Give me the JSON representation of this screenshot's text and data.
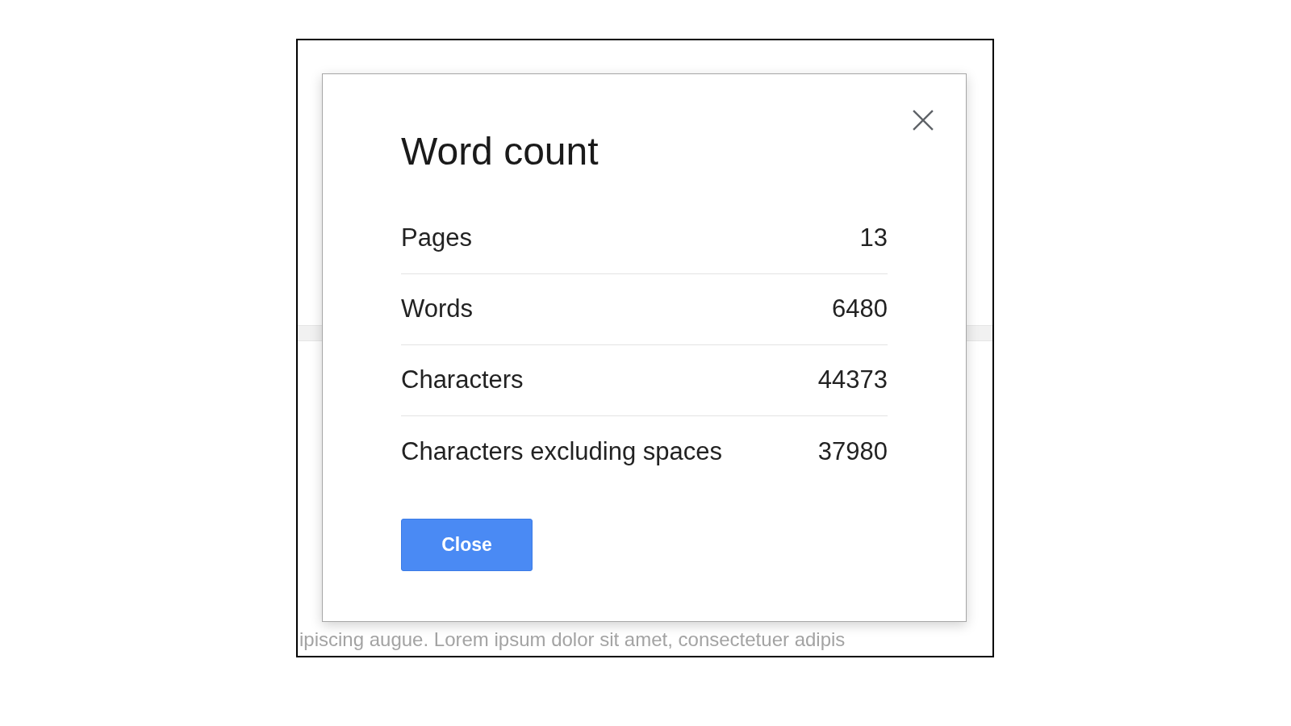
{
  "dialog": {
    "title": "Word count",
    "rows": [
      {
        "label": "Pages",
        "value": "13"
      },
      {
        "label": "Words",
        "value": "6480"
      },
      {
        "label": "Characters",
        "value": "44373"
      },
      {
        "label": "Characters excluding spaces",
        "value": "37980"
      }
    ],
    "button": "Close"
  },
  "document": {
    "text": "ipiscing augue. Lorem ipsum dolor sit amet, consectetuer adipis"
  }
}
